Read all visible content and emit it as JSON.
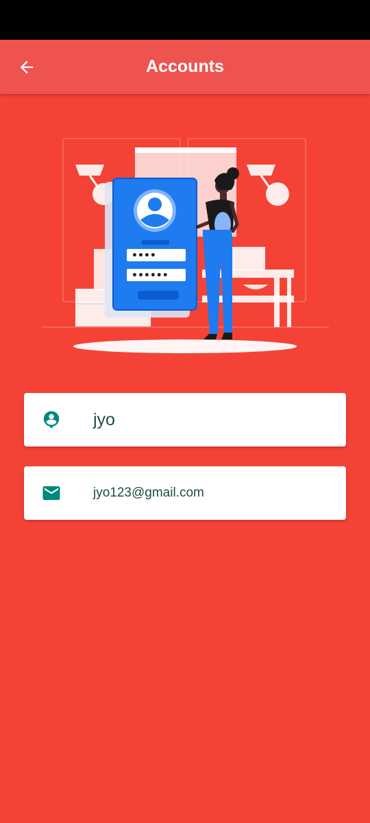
{
  "app_bar": {
    "title": "Accounts",
    "back_icon": "arrow-back-icon"
  },
  "profile": {
    "name": "jyo",
    "name_icon": "person-pin-icon",
    "email": "jyo123@gmail.com",
    "email_icon": "email-icon"
  },
  "colors": {
    "background": "#F44336",
    "app_bar": "#EF5350",
    "card": "#FFFFFF",
    "icon": "#00897B",
    "text": "#1B4D44",
    "illustration_blue": "#1E7BF0"
  }
}
